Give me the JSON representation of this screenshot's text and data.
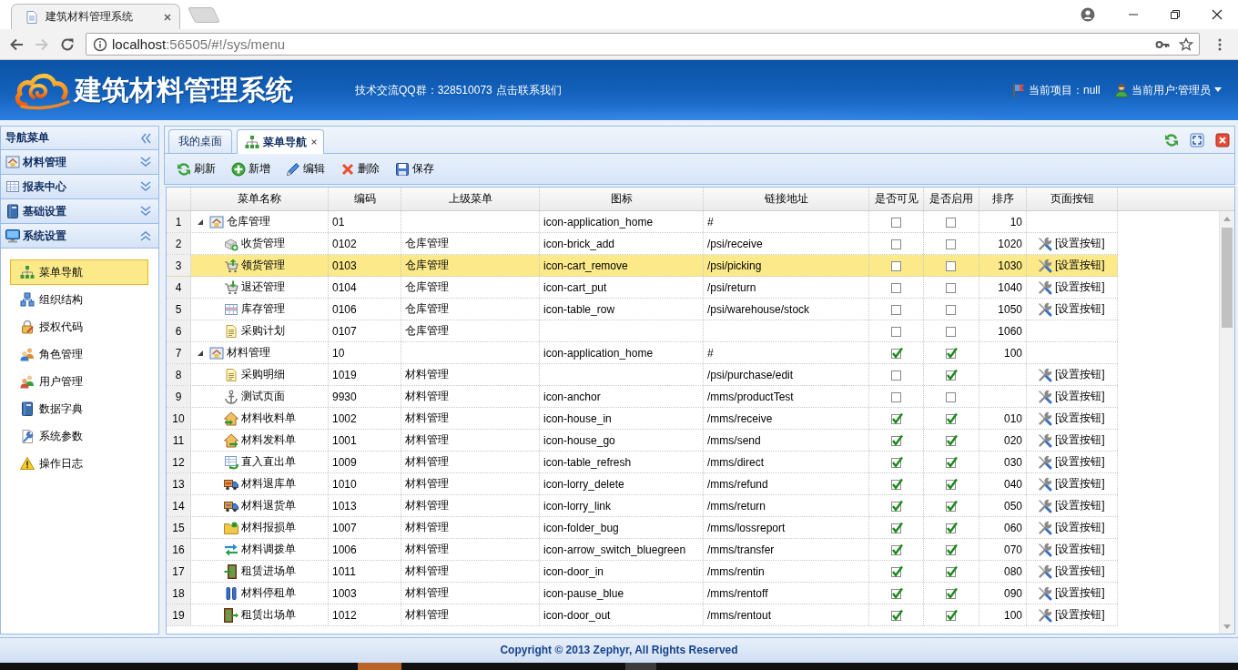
{
  "browser": {
    "tab_title": "建筑材料管理系统",
    "url_host": "localhost",
    "url_path": ":56505/#!/sys/menu"
  },
  "header": {
    "title": "建筑材料管理系统",
    "qq_group": "技术交流QQ群：328510073",
    "contact_link": "点击联系我们",
    "project": "当前项目：null",
    "user": "当前用户:管理员"
  },
  "sidebar": {
    "title": "导航菜单",
    "sections": [
      {
        "label": "材料管理",
        "expanded": false
      },
      {
        "label": "报表中心",
        "expanded": false
      },
      {
        "label": "基础设置",
        "expanded": false
      },
      {
        "label": "系统设置",
        "expanded": true,
        "items": [
          {
            "label": "菜单导航",
            "selected": true
          },
          {
            "label": "组织结构",
            "selected": false
          },
          {
            "label": "授权代码",
            "selected": false
          },
          {
            "label": "角色管理",
            "selected": false
          },
          {
            "label": "用户管理",
            "selected": false
          },
          {
            "label": "数据字典",
            "selected": false
          },
          {
            "label": "系统参数",
            "selected": false
          },
          {
            "label": "操作日志",
            "selected": false
          }
        ]
      }
    ]
  },
  "tabs": [
    {
      "label": "我的桌面",
      "selected": false,
      "closable": false
    },
    {
      "label": "菜单导航",
      "selected": true,
      "closable": true
    }
  ],
  "toolbar": [
    {
      "label": "刷新"
    },
    {
      "label": "新增"
    },
    {
      "label": "编辑"
    },
    {
      "label": "删除"
    },
    {
      "label": "保存"
    }
  ],
  "table": {
    "columns": [
      "菜单名称",
      "编码",
      "上级菜单",
      "图标",
      "链接地址",
      "是否可见",
      "是否启用",
      "排序",
      "页面按钮"
    ],
    "rows": [
      {
        "number": "1",
        "name": "仓库管理",
        "code": "01",
        "icon_class": "icon-application_home",
        "link": "#",
        "visible": false,
        "enabled": false,
        "sort": "10",
        "selected": false,
        "expanded": true,
        "children": [
          {
            "number": "2",
            "name": "收货管理",
            "code": "0102",
            "parent": "仓库管理",
            "icon_class": "icon-brick_add",
            "link": "/psi/receive",
            "visible": false,
            "enabled": false,
            "sort": "1020",
            "action": "[设置按钮]",
            "selected": false
          },
          {
            "number": "3",
            "name": "领货管理",
            "code": "0103",
            "parent": "仓库管理",
            "icon_class": "icon-cart_remove",
            "link": "/psi/picking",
            "visible": false,
            "enabled": false,
            "sort": "1030",
            "action": "[设置按钮]",
            "selected": true
          },
          {
            "number": "4",
            "name": "退还管理",
            "code": "0104",
            "parent": "仓库管理",
            "icon_class": "icon-cart_put",
            "link": "/psi/return",
            "visible": false,
            "enabled": false,
            "sort": "1040",
            "action": "[设置按钮]",
            "selected": false
          },
          {
            "number": "5",
            "name": "库存管理",
            "code": "0106",
            "parent": "仓库管理",
            "icon_class": "icon-table_row",
            "link": "/psi/warehouse/stock",
            "visible": false,
            "enabled": false,
            "sort": "1050",
            "action": "[设置按钮]",
            "selected": false
          },
          {
            "number": "6",
            "name": "采购计划",
            "code": "0107",
            "parent": "仓库管理",
            "visible": false,
            "enabled": false,
            "sort": "1060",
            "selected": false
          }
        ]
      },
      {
        "number": "7",
        "name": "材料管理",
        "code": "10",
        "icon_class": "icon-application_home",
        "link": "#",
        "visible": true,
        "enabled": true,
        "sort": "100",
        "selected": false,
        "expanded": true,
        "children": [
          {
            "number": "8",
            "name": "采购明细",
            "code": "1019",
            "parent": "材料管理",
            "link": "/psi/purchase/edit",
            "visible": false,
            "enabled": true,
            "action": "[设置按钮]",
            "selected": false
          },
          {
            "number": "9",
            "name": "测试页面",
            "code": "9930",
            "parent": "材料管理",
            "icon_class": "icon-anchor",
            "link": "/mms/productTest",
            "visible": false,
            "enabled": false,
            "action": "[设置按钮]",
            "selected": false
          },
          {
            "number": "10",
            "name": "材料收料单",
            "code": "1002",
            "parent": "材料管理",
            "icon_class": "icon-house_in",
            "link": "/mms/receive",
            "visible": true,
            "enabled": true,
            "sort": "010",
            "action": "[设置按钮]",
            "selected": false
          },
          {
            "number": "11",
            "name": "材料发料单",
            "code": "1001",
            "parent": "材料管理",
            "icon_class": "icon-house_go",
            "link": "/mms/send",
            "visible": true,
            "enabled": true,
            "sort": "020",
            "action": "[设置按钮]",
            "selected": false
          },
          {
            "number": "12",
            "name": "直入直出单",
            "code": "1009",
            "parent": "材料管理",
            "icon_class": "icon-table_refresh",
            "link": "/mms/direct",
            "visible": true,
            "enabled": true,
            "sort": "030",
            "action": "[设置按钮]",
            "selected": false
          },
          {
            "number": "13",
            "name": "材料退库单",
            "code": "1010",
            "parent": "材料管理",
            "icon_class": "icon-lorry_delete",
            "link": "/mms/refund",
            "visible": true,
            "enabled": true,
            "sort": "040",
            "action": "[设置按钮]",
            "selected": false
          },
          {
            "number": "14",
            "name": "材料退货单",
            "code": "1013",
            "parent": "材料管理",
            "icon_class": "icon-lorry_link",
            "link": "/mms/return",
            "visible": true,
            "enabled": true,
            "sort": "050",
            "action": "[设置按钮]",
            "selected": false
          },
          {
            "number": "15",
            "name": "材料报损单",
            "code": "1007",
            "parent": "材料管理",
            "icon_class": "icon-folder_bug",
            "link": "/mms/lossreport",
            "visible": true,
            "enabled": true,
            "sort": "060",
            "action": "[设置按钮]",
            "selected": false
          },
          {
            "number": "16",
            "name": "材料调拨单",
            "code": "1006",
            "parent": "材料管理",
            "icon_class": "icon-arrow_switch_bluegreen",
            "link": "/mms/transfer",
            "visible": true,
            "enabled": true,
            "sort": "070",
            "action": "[设置按钮]",
            "selected": false
          },
          {
            "number": "17",
            "name": "租赁进场单",
            "code": "1011",
            "parent": "材料管理",
            "icon_class": "icon-door_in",
            "link": "/mms/rentin",
            "visible": true,
            "enabled": true,
            "sort": "080",
            "action": "[设置按钮]",
            "selected": false
          },
          {
            "number": "18",
            "name": "材料停租单",
            "code": "1003",
            "parent": "材料管理",
            "icon_class": "icon-pause_blue",
            "link": "/mms/rentoff",
            "visible": true,
            "enabled": true,
            "sort": "090",
            "action": "[设置按钮]",
            "selected": false
          },
          {
            "number": "19",
            "name": "租赁出场单",
            "code": "1012",
            "parent": "材料管理",
            "icon_class": "icon-door_out",
            "link": "/mms/rentout",
            "visible": true,
            "enabled": true,
            "sort": "100",
            "action": "[设置按钮]",
            "selected": false
          }
        ]
      }
    ]
  },
  "footer": "Copyright © 2013 Zephyr, All Rights Reserved"
}
